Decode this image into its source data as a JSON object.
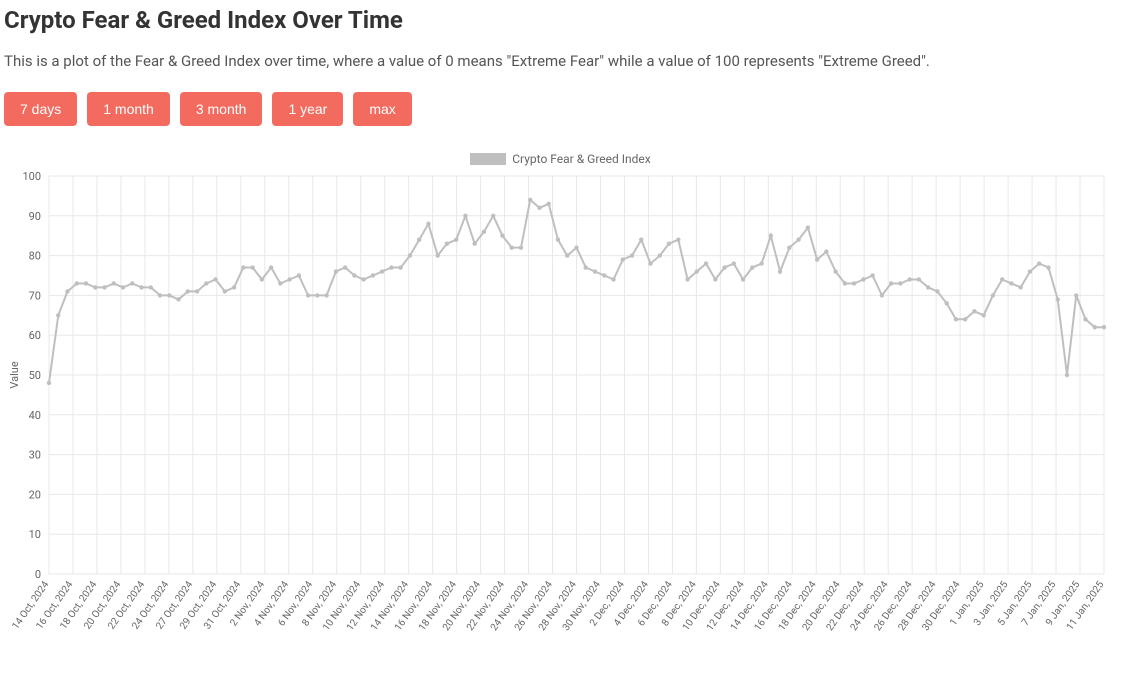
{
  "header": {
    "title": "Crypto Fear & Greed Index Over Time",
    "subtitle": "This is a plot of the Fear & Greed Index over time, where a value of 0 means \"Extreme Fear\" while a value of 100 represents \"Extreme Greed\"."
  },
  "buttons": {
    "d7": "7 days",
    "m1": "1 month",
    "m3": "3 month",
    "y1": "1 year",
    "max": "max"
  },
  "legend": {
    "label": "Crypto Fear & Greed Index"
  },
  "axis": {
    "ylabel": "Value"
  },
  "chart_data": {
    "type": "line",
    "title": "Crypto Fear & Greed Index Over Time",
    "xlabel": "",
    "ylabel": "Value",
    "ylim": [
      0,
      100
    ],
    "x_tick_labels": [
      "14 Oct, 2024",
      "16 Oct, 2024",
      "18 Oct, 2024",
      "20 Oct, 2024",
      "22 Oct, 2024",
      "24 Oct, 2024",
      "27 Oct, 2024",
      "29 Oct, 2024",
      "31 Oct, 2024",
      "2 Nov, 2024",
      "4 Nov, 2024",
      "6 Nov, 2024",
      "8 Nov, 2024",
      "10 Nov, 2024",
      "12 Nov, 2024",
      "14 Nov, 2024",
      "16 Nov, 2024",
      "18 Nov, 2024",
      "20 Nov, 2024",
      "22 Nov, 2024",
      "24 Nov, 2024",
      "26 Nov, 2024",
      "28 Nov, 2024",
      "30 Nov, 2024",
      "2 Dec, 2024",
      "4 Dec, 2024",
      "6 Dec, 2024",
      "8 Dec, 2024",
      "10 Dec, 2024",
      "12 Dec, 2024",
      "14 Dec, 2024",
      "16 Dec, 2024",
      "18 Dec, 2024",
      "20 Dec, 2024",
      "22 Dec, 2024",
      "24 Dec, 2024",
      "26 Dec, 2024",
      "28 Dec, 2024",
      "30 Dec, 2024",
      "1 Jan, 2025",
      "3 Jan, 2025",
      "5 Jan, 2025",
      "7 Jan, 2025",
      "9 Jan, 2025",
      "11 Jan, 2025"
    ],
    "y_tick_labels": [
      "0",
      "10",
      "20",
      "30",
      "40",
      "50",
      "60",
      "70",
      "80",
      "90",
      "100"
    ],
    "series": [
      {
        "name": "Crypto Fear & Greed Index",
        "color": "#bfbfbf",
        "values": [
          48,
          65,
          71,
          73,
          73,
          72,
          72,
          73,
          72,
          73,
          72,
          72,
          70,
          70,
          69,
          71,
          71,
          73,
          74,
          71,
          72,
          77,
          77,
          74,
          77,
          73,
          74,
          75,
          70,
          70,
          70,
          76,
          77,
          75,
          74,
          75,
          76,
          77,
          77,
          80,
          84,
          88,
          80,
          83,
          84,
          90,
          83,
          86,
          90,
          85,
          82,
          82,
          94,
          92,
          93,
          84,
          80,
          82,
          77,
          76,
          75,
          74,
          79,
          80,
          84,
          78,
          80,
          83,
          84,
          74,
          76,
          78,
          74,
          77,
          78,
          74,
          77,
          78,
          85,
          76,
          82,
          84,
          87,
          79,
          81,
          76,
          73,
          73,
          74,
          75,
          70,
          73,
          73,
          74,
          74,
          72,
          71,
          68,
          64,
          64,
          66,
          65,
          70,
          74,
          73,
          72,
          76,
          78,
          77,
          69,
          50,
          70,
          64,
          62,
          62
        ]
      }
    ]
  }
}
